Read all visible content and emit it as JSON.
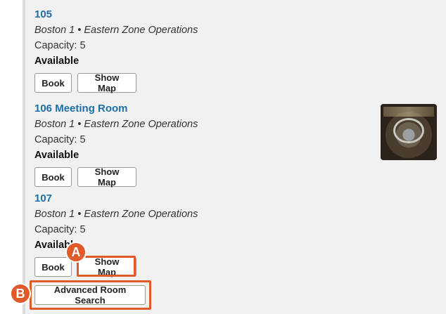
{
  "rooms": [
    {
      "title": "105",
      "location": "Boston 1 • Eastern Zone Operations",
      "capacity": "Capacity: 5",
      "status": "Available",
      "book_label": "Book",
      "map_label": "Show Map"
    },
    {
      "title": "106 Meeting Room",
      "location": "Boston 1 • Eastern Zone Operations",
      "capacity": "Capacity: 5",
      "status": "Available",
      "book_label": "Book",
      "map_label": "Show Map"
    },
    {
      "title": "107",
      "location": "Boston 1 • Eastern Zone Operations",
      "capacity": "Capacity: 5",
      "status": "Available",
      "book_label": "Book",
      "map_label": "Show Map"
    }
  ],
  "advanced_search_label": "Advanced Room Search",
  "callouts": {
    "a_label": "A",
    "b_label": "B",
    "accent_color": "#e15a2b"
  },
  "colors": {
    "link": "#1d6fa5",
    "panel_bg": "#f1f1f1"
  }
}
